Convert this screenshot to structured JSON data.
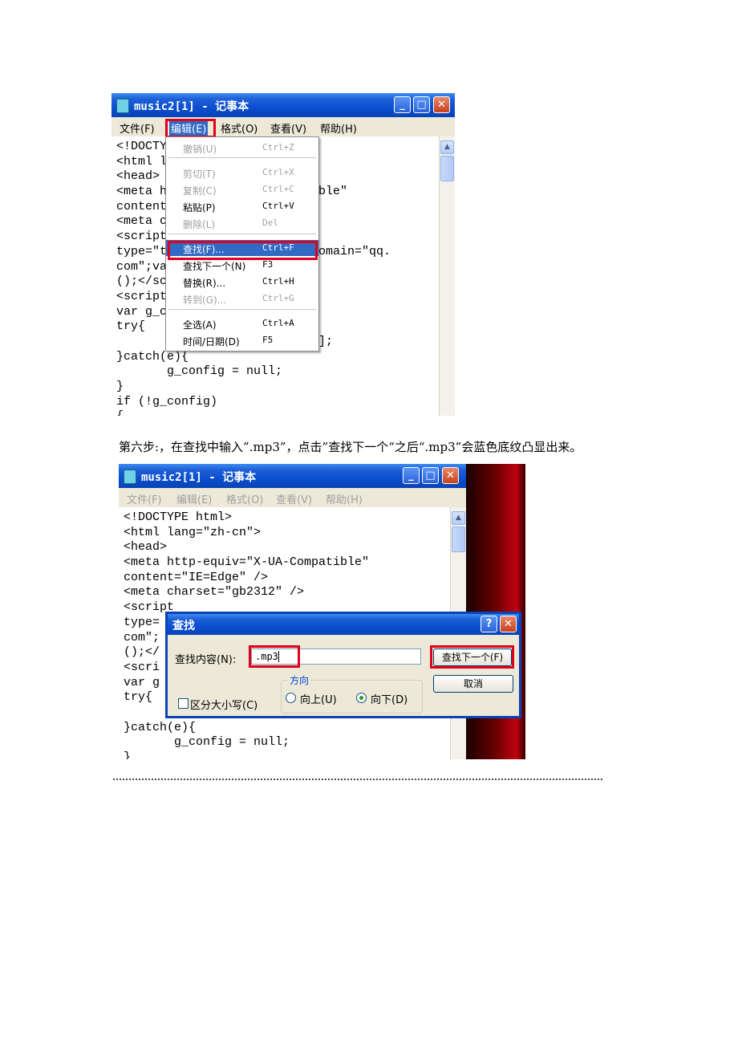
{
  "screenshot1": {
    "window_title": "music2[1] - 记事本",
    "menu": [
      "文件(F)",
      "编辑(E)",
      "格式(O)",
      "查看(V)",
      "帮助(H)"
    ],
    "window_buttons": {
      "minimize": "_",
      "maximize": "□",
      "close": "✕"
    },
    "editor_lines": [
      "<!DOCTY",
      "<html l",
      "<head>",
      "<meta h                  atible\"",
      "content",
      "<meta c",
      "<script",
      "type=\"t               ment.domain=\"qq.",
      "com\";va              w Date",
      "();</sc",
      "<script               pt\">",
      "var g_c",
      "try{",
      "                      onfig\"];",
      "}catch(e){",
      "       g_config = null;",
      "}",
      "if (!g_config)",
      "{"
    ],
    "edit_menu_items": [
      {
        "label": "撤销(U)",
        "shortcut": "Ctrl+Z",
        "enabled": false
      },
      {
        "label": "剪切(T)",
        "shortcut": "Ctrl+X",
        "enabled": false
      },
      {
        "label": "复制(C)",
        "shortcut": "Ctrl+C",
        "enabled": false
      },
      {
        "label": "粘贴(P)",
        "shortcut": "Ctrl+V",
        "enabled": true
      },
      {
        "label": "删除(L)",
        "shortcut": "Del",
        "enabled": false
      },
      {
        "label": "查找(F)...",
        "shortcut": "Ctrl+F",
        "enabled": true,
        "selected": true
      },
      {
        "label": "查找下一个(N)",
        "shortcut": "F3",
        "enabled": true
      },
      {
        "label": "替换(R)...",
        "shortcut": "Ctrl+H",
        "enabled": true
      },
      {
        "label": "转到(G)...",
        "shortcut": "Ctrl+G",
        "enabled": false
      },
      {
        "label": "全选(A)",
        "shortcut": "Ctrl+A",
        "enabled": true
      },
      {
        "label": "时间/日期(D)",
        "shortcut": "F5",
        "enabled": true
      }
    ]
  },
  "caption": "第六步:，在查找中输入”.mp3”，点击”查找下一个“之后“.mp3”会蓝色底纹凸显出来。",
  "screenshot2": {
    "window_title": "music2[1] - 记事本",
    "menu": [
      "文件(F)",
      "编辑(E)",
      "格式(O)",
      "查看(V)",
      "帮助(H)"
    ],
    "window_buttons": {
      "minimize": "_",
      "maximize": "□",
      "close": "✕"
    },
    "editor_lines": [
      "<!DOCTYPE html>",
      "<html lang=\"zh-cn\">",
      "<head>",
      "<meta http-equiv=\"X-UA-Compatible\"",
      "content=\"IE=Edge\" />",
      "<meta charset=\"gb2312\" />",
      "<script",
      "type=",
      "com\";",
      "();</",
      "<scri",
      "var g",
      "try{",
      "",
      "}catch(e){",
      "       g_config = null;",
      "}"
    ],
    "find_dialog": {
      "title": "查找",
      "help_button": "?",
      "close_button": "✕",
      "find_label": "查找内容(N):",
      "find_value": ".mp3",
      "find_next_button": "查找下一个(F)",
      "cancel_button": "取消",
      "direction_label": "方向",
      "up_label": "向上(U)",
      "down_label": "向下(D)",
      "direction_selected": "down",
      "match_case_label": "区分大小写(C)",
      "match_case_checked": false
    }
  },
  "colors": {
    "highlight_border": "#e0001b",
    "menu_selection": "#316ac5",
    "xp_title": "#0b4fd0"
  }
}
